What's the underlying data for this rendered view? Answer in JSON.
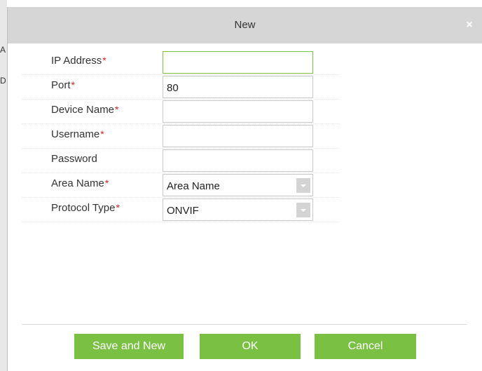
{
  "dialog": {
    "title": "New",
    "close_symbol": "×"
  },
  "background": {
    "fragments": [
      "A",
      "D"
    ]
  },
  "form": {
    "ip_address": {
      "label": "IP Address",
      "required": "*",
      "value": ""
    },
    "port": {
      "label": "Port",
      "required": "*",
      "value": "80"
    },
    "device_name": {
      "label": "Device Name",
      "required": "*",
      "value": ""
    },
    "username": {
      "label": "Username",
      "required": "*",
      "value": ""
    },
    "password": {
      "label": "Password",
      "value": ""
    },
    "area_name": {
      "label": "Area Name",
      "required": "*",
      "selected": "Area Name"
    },
    "protocol_type": {
      "label": "Protocol Type",
      "required": "*",
      "selected": "ONVIF"
    }
  },
  "buttons": {
    "save_and_new": "Save and New",
    "ok": "OK",
    "cancel": "Cancel"
  },
  "colors": {
    "accent_green": "#7ac143",
    "title_bar": "#d6d6d6",
    "required_star": "#e02020",
    "focus_border": "#7bc142"
  }
}
